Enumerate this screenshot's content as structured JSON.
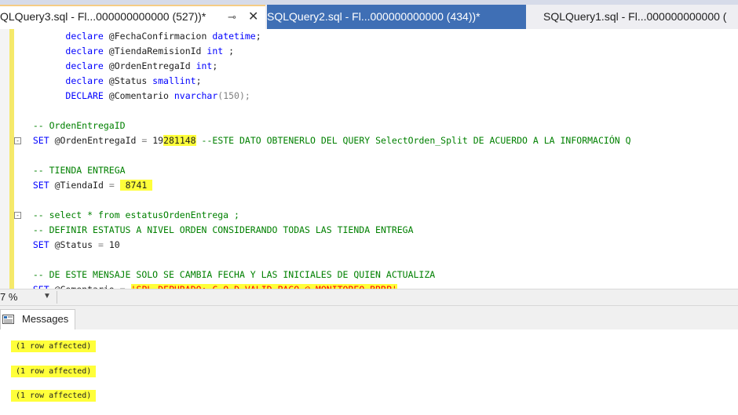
{
  "tabs": [
    {
      "label": "QLQuery3.sql - Fl...000000000000 (527))*",
      "pin": "⊸",
      "close": "✕"
    },
    {
      "label": "SQLQuery2.sql - Fl...000000000000 (434))*"
    },
    {
      "label": "SQLQuery1.sql - Fl...000000000000 ("
    }
  ],
  "editor": {
    "lines": [
      {
        "indent": "        ",
        "tokens": [
          {
            "t": "declare",
            "c": "kw"
          },
          {
            "t": " @FechaConfirmacion "
          },
          {
            "t": "datetime",
            "c": "kw"
          },
          {
            "t": ";"
          }
        ]
      },
      {
        "indent": "        ",
        "tokens": [
          {
            "t": "declare",
            "c": "kw"
          },
          {
            "t": " @TiendaRemisionId "
          },
          {
            "t": "int",
            "c": "kw"
          },
          {
            "t": " ;"
          }
        ]
      },
      {
        "indent": "        ",
        "tokens": [
          {
            "t": "declare",
            "c": "kw"
          },
          {
            "t": " @OrdenEntregaId "
          },
          {
            "t": "int",
            "c": "kw"
          },
          {
            "t": ";"
          }
        ]
      },
      {
        "indent": "        ",
        "tokens": [
          {
            "t": "declare",
            "c": "kw"
          },
          {
            "t": " @Status "
          },
          {
            "t": "smallint",
            "c": "kw"
          },
          {
            "t": ";"
          }
        ]
      },
      {
        "indent": "        ",
        "tokens": [
          {
            "t": "DECLARE",
            "c": "kw"
          },
          {
            "t": " @Comentario "
          },
          {
            "t": "nvarchar",
            "c": "kw"
          },
          {
            "t": "(150);",
            "c": "gr"
          }
        ]
      },
      {
        "indent": "",
        "tokens": []
      },
      {
        "indent": "  ",
        "tokens": [
          {
            "t": "-- OrdenEntregaID",
            "c": "cm"
          }
        ]
      },
      {
        "indent": "  ",
        "fold": "-",
        "tokens": [
          {
            "t": "SET",
            "c": "kw"
          },
          {
            "t": " @OrdenEntregaId "
          },
          {
            "t": "=",
            "c": "gr"
          },
          {
            "t": " 19"
          },
          {
            "t": "281148",
            "c": "hl"
          },
          {
            "t": " "
          },
          {
            "t": "--ESTE DATO OBTENERLO DEL QUERY SelectOrden_Split DE ACUERDO A LA INFORMACIÓN Q",
            "c": "cm"
          }
        ]
      },
      {
        "indent": "",
        "tokens": []
      },
      {
        "indent": "  ",
        "tokens": [
          {
            "t": "-- TIENDA ENTREGA",
            "c": "cm"
          }
        ]
      },
      {
        "indent": "  ",
        "tokens": [
          {
            "t": "SET",
            "c": "kw"
          },
          {
            "t": " @TiendaId "
          },
          {
            "t": "=",
            "c": "gr"
          },
          {
            "t": " "
          },
          {
            "t": " 8741 ",
            "c": "hl"
          }
        ]
      },
      {
        "indent": "",
        "tokens": []
      },
      {
        "indent": "  ",
        "fold": "-",
        "tokens": [
          {
            "t": "-- select * from estatusOrdenEntrega ;",
            "c": "cm"
          }
        ]
      },
      {
        "indent": "  ",
        "tokens": [
          {
            "t": "-- DEFINIR ESTATUS A NIVEL ORDEN CONSIDERANDO TODAS LAS TIENDA ENTREGA",
            "c": "cm"
          }
        ]
      },
      {
        "indent": "  ",
        "tokens": [
          {
            "t": "SET",
            "c": "kw"
          },
          {
            "t": " @Status "
          },
          {
            "t": "=",
            "c": "gr"
          },
          {
            "t": " 10"
          }
        ]
      },
      {
        "indent": "",
        "tokens": []
      },
      {
        "indent": "  ",
        "tokens": [
          {
            "t": "-- DE ESTE MENSAJE SOLO SE CAMBIA FECHA Y LAS INICIALES DE QUIEN ACTUALIZA",
            "c": "cm"
          }
        ]
      },
      {
        "indent": "  ",
        "tokens": [
          {
            "t": "SET",
            "c": "kw"
          },
          {
            "t": " @Comentario "
          },
          {
            "t": "=",
            "c": "gr"
          },
          {
            "t": " "
          },
          {
            "t": "'SPL DEPURADO: C.O.D VALID PAGO @ MONITOREO BRRP'",
            "c": "str hl"
          }
        ]
      }
    ]
  },
  "zoom": {
    "value": "7 %",
    "dropdown": "▼"
  },
  "results": {
    "tab_label": "Messages",
    "messages": [
      "(1 row affected)",
      "(1 row affected)",
      "(1 row affected)"
    ]
  }
}
